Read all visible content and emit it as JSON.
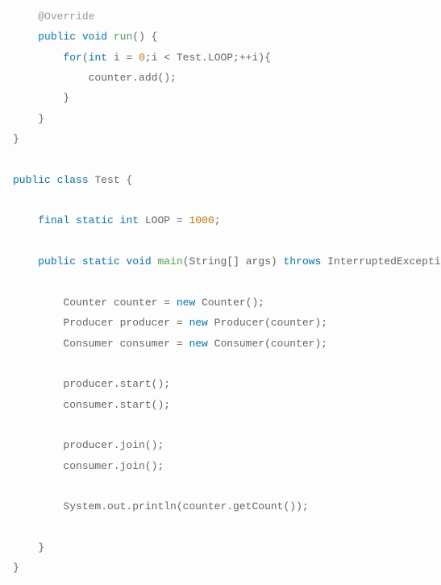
{
  "code": {
    "line1_annotation": "@Override",
    "line2_kw1": "public",
    "line2_kw2": "void",
    "line2_method": "run",
    "line2_rest": "() {",
    "line3_kw1": "for",
    "line3_paren": "(",
    "line3_kw2": "int",
    "line3_var": " i = ",
    "line3_num": "0",
    "line3_rest": ";i < Test.LOOP;++i){",
    "line4": "counter.add();",
    "line5": "}",
    "line6": "}",
    "line7": "}",
    "line8_kw1": "public",
    "line8_kw2": "class",
    "line8_name": "Test",
    "line8_brace": " {",
    "line9_kw1": "final",
    "line9_kw2": "static",
    "line9_kw3": "int",
    "line9_var": " LOOP = ",
    "line9_num": "1000",
    "line9_semi": ";",
    "line10_kw1": "public",
    "line10_kw2": "static",
    "line10_kw3": "void",
    "line10_method": "main",
    "line10_params": "(String[] args) ",
    "line10_kw4": "throws",
    "line10_rest": " InterruptedException {",
    "line11_a": "Counter counter = ",
    "line11_kw": "new",
    "line11_b": " Counter();",
    "line12_a": "Producer producer = ",
    "line12_kw": "new",
    "line12_b": " Producer(counter);",
    "line13_a": "Consumer consumer = ",
    "line13_kw": "new",
    "line13_b": " Consumer(counter);",
    "line14": "producer.start();",
    "line15": "consumer.start();",
    "line16": "producer.join();",
    "line17": "consumer.join();",
    "line18": "System.out.println(counter.getCount());",
    "line19": "}",
    "line20": "}"
  }
}
